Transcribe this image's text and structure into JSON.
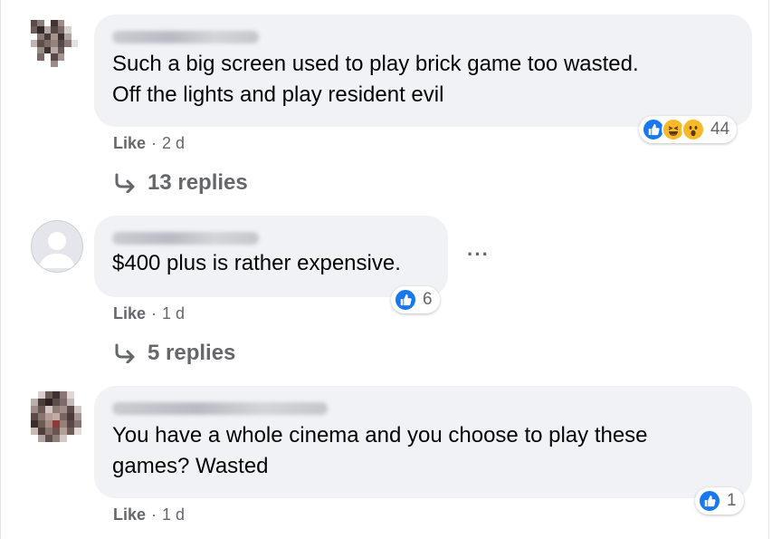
{
  "comments": [
    {
      "text": "Such a big screen used to play brick game too wasted.\nOff the lights and play resident evil",
      "reactions": {
        "icons": [
          "like-icon",
          "haha-icon",
          "wow-icon"
        ],
        "count": "44"
      },
      "like_label": "Like",
      "time": "2 d",
      "replies_label": "13 replies"
    },
    {
      "text": "$400 plus is rather expensive.",
      "reactions": {
        "icons": [
          "like-icon"
        ],
        "count": "6"
      },
      "like_label": "Like",
      "time": "1 d",
      "replies_label": "5 replies"
    },
    {
      "text": "You have a whole cinema and you choose to play these\ngames? Wasted",
      "reactions": {
        "icons": [
          "like-icon"
        ],
        "count": "1"
      },
      "like_label": "Like",
      "time": "1 d"
    }
  ],
  "colors": {
    "bubble": "#f0f2f5",
    "meta_text": "#65676b",
    "like_blue": "#1877f2",
    "emoji_yellow": "#f7b928"
  }
}
